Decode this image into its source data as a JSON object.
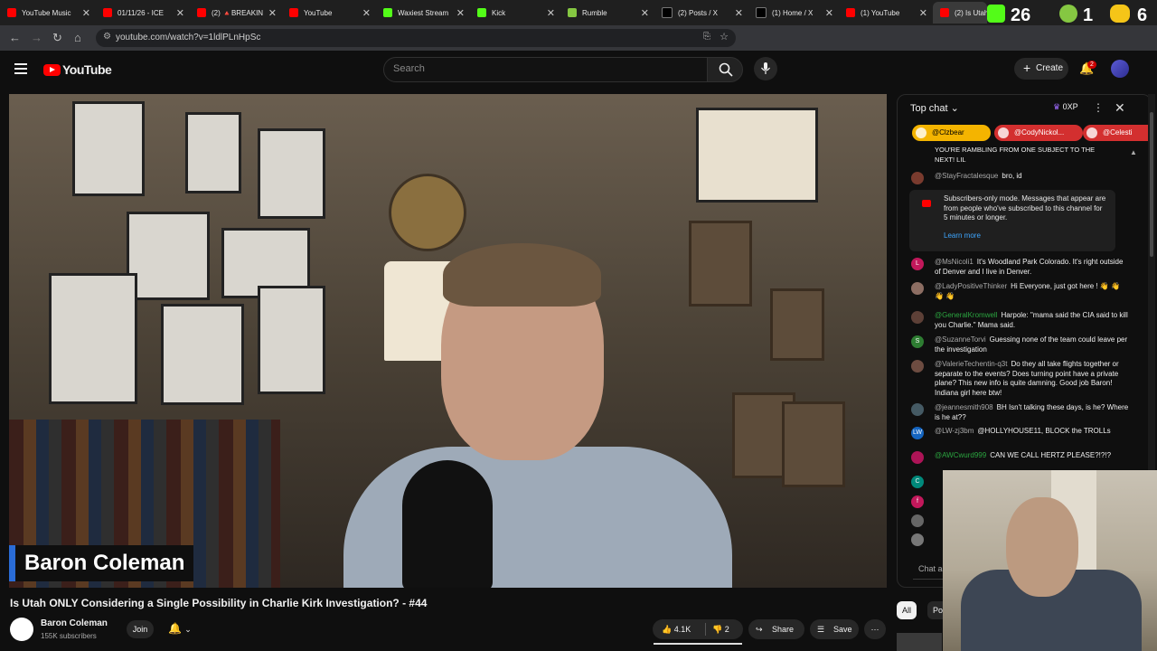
{
  "tabs": [
    {
      "title": "YouTube Music",
      "color": "#ff0000"
    },
    {
      "title": "01/11/26 - ICE",
      "color": "#ff0000"
    },
    {
      "title": "(2) 🔺BREAKIN",
      "color": "#ff0000"
    },
    {
      "title": "YouTube",
      "color": "#ff0000"
    },
    {
      "title": "Waxiest Stream",
      "color": "#53fc18"
    },
    {
      "title": "Kick",
      "color": "#53fc18"
    },
    {
      "title": "Rumble",
      "color": "#85c742"
    },
    {
      "title": "(2) Posts / X",
      "color": "#000000"
    },
    {
      "title": "(1) Home / X",
      "color": "#000000"
    },
    {
      "title": "(1) YouTube",
      "color": "#ff0000"
    },
    {
      "title": "(2) Is Utah",
      "color": "#ff0000"
    }
  ],
  "overlay_stats": {
    "stat1": "26",
    "stat2": "1",
    "stat3": "6"
  },
  "address": {
    "url": "youtube.com/watch?v=1ldlPLnHpSc"
  },
  "header": {
    "logo_text": "YouTube",
    "search_placeholder": "Search",
    "create_label": "Create",
    "notifications_count": "2"
  },
  "video": {
    "lower_third": "Baron Coleman",
    "title": "Is Utah ONLY Considering a Single Possibility in Charlie Kirk Investigation? - #44"
  },
  "channel": {
    "name": "Baron Coleman",
    "subscribers": "155K subscribers",
    "join_label": "Join"
  },
  "actions": {
    "likes": "4.1K",
    "dislikes": "2",
    "share": "Share",
    "save": "Save"
  },
  "chat": {
    "header": "Top chat",
    "xp": "0XP",
    "tickers": [
      {
        "name": "@Clzbear",
        "color": "#f4b400"
      },
      {
        "name": "@CodyNickol...",
        "color": "#d32f2f"
      },
      {
        "name": "@Celesti",
        "color": "#d32f2f"
      }
    ],
    "truncated_top": "YOU'RE RAMBLING FROM ONE SUBJECT TO THE NEXT! LIL",
    "notice_text": "Subscribers-only mode. Messages that appear are from people who've subscribed to this channel for 5 minutes or longer.",
    "notice_link": "Learn more",
    "messages": [
      {
        "author": "@StayFractalesque",
        "text": "bro, id",
        "avatar": "",
        "color": "#7a3b2e"
      },
      {
        "author": "@MsNicoli1",
        "text": "It's Woodland Park Colorado. It's right outside of Denver and I live in Denver.",
        "avatar": "L",
        "color": "#c2185b"
      },
      {
        "author": "@LadyPositiveThinker",
        "text": "Hi Everyone, just got here ! 👋 👋 👋 👋",
        "avatar": "",
        "color": "#8d6e63"
      },
      {
        "author": "@GeneralKromwell",
        "text": "Harpole: \"mama said the CIA said to kill you Charlie.\" Mama said.",
        "avatar": "",
        "color": "#5d4037"
      },
      {
        "author": "@SuzanneTorvi",
        "text": "Guessing none of the team could leave per the investigation",
        "avatar": "S",
        "color": "#2e7d32"
      },
      {
        "author": "@ValerieTechentin-q3t",
        "text": "Do they all take flights together or separate to the events? Does turning point have a private plane? This new info is quite damning. Good job Baron! Indiana girl here btw!",
        "avatar": "",
        "color": "#6d4c41"
      },
      {
        "author": "@jeannesmith908",
        "text": "BH Isn't talking these days, is he? Where is he at??",
        "avatar": "",
        "color": "#455a64"
      },
      {
        "author": "@LW-zj3bm",
        "text": "@HOLLYHOUSE11, BLOCK the TROLLs",
        "avatar": "LW",
        "color": "#1565c0"
      },
      {
        "author": "@AWCwurd999",
        "text": "CAN WE CALL HERTZ PLEASE?!?!?",
        "avatar": "",
        "color": "#ad1457"
      }
    ],
    "input_placeholder": "Chat as",
    "author_initials": [
      "C",
      "f",
      "",
      ""
    ]
  },
  "chips": {
    "all": "All",
    "second": "Po"
  }
}
